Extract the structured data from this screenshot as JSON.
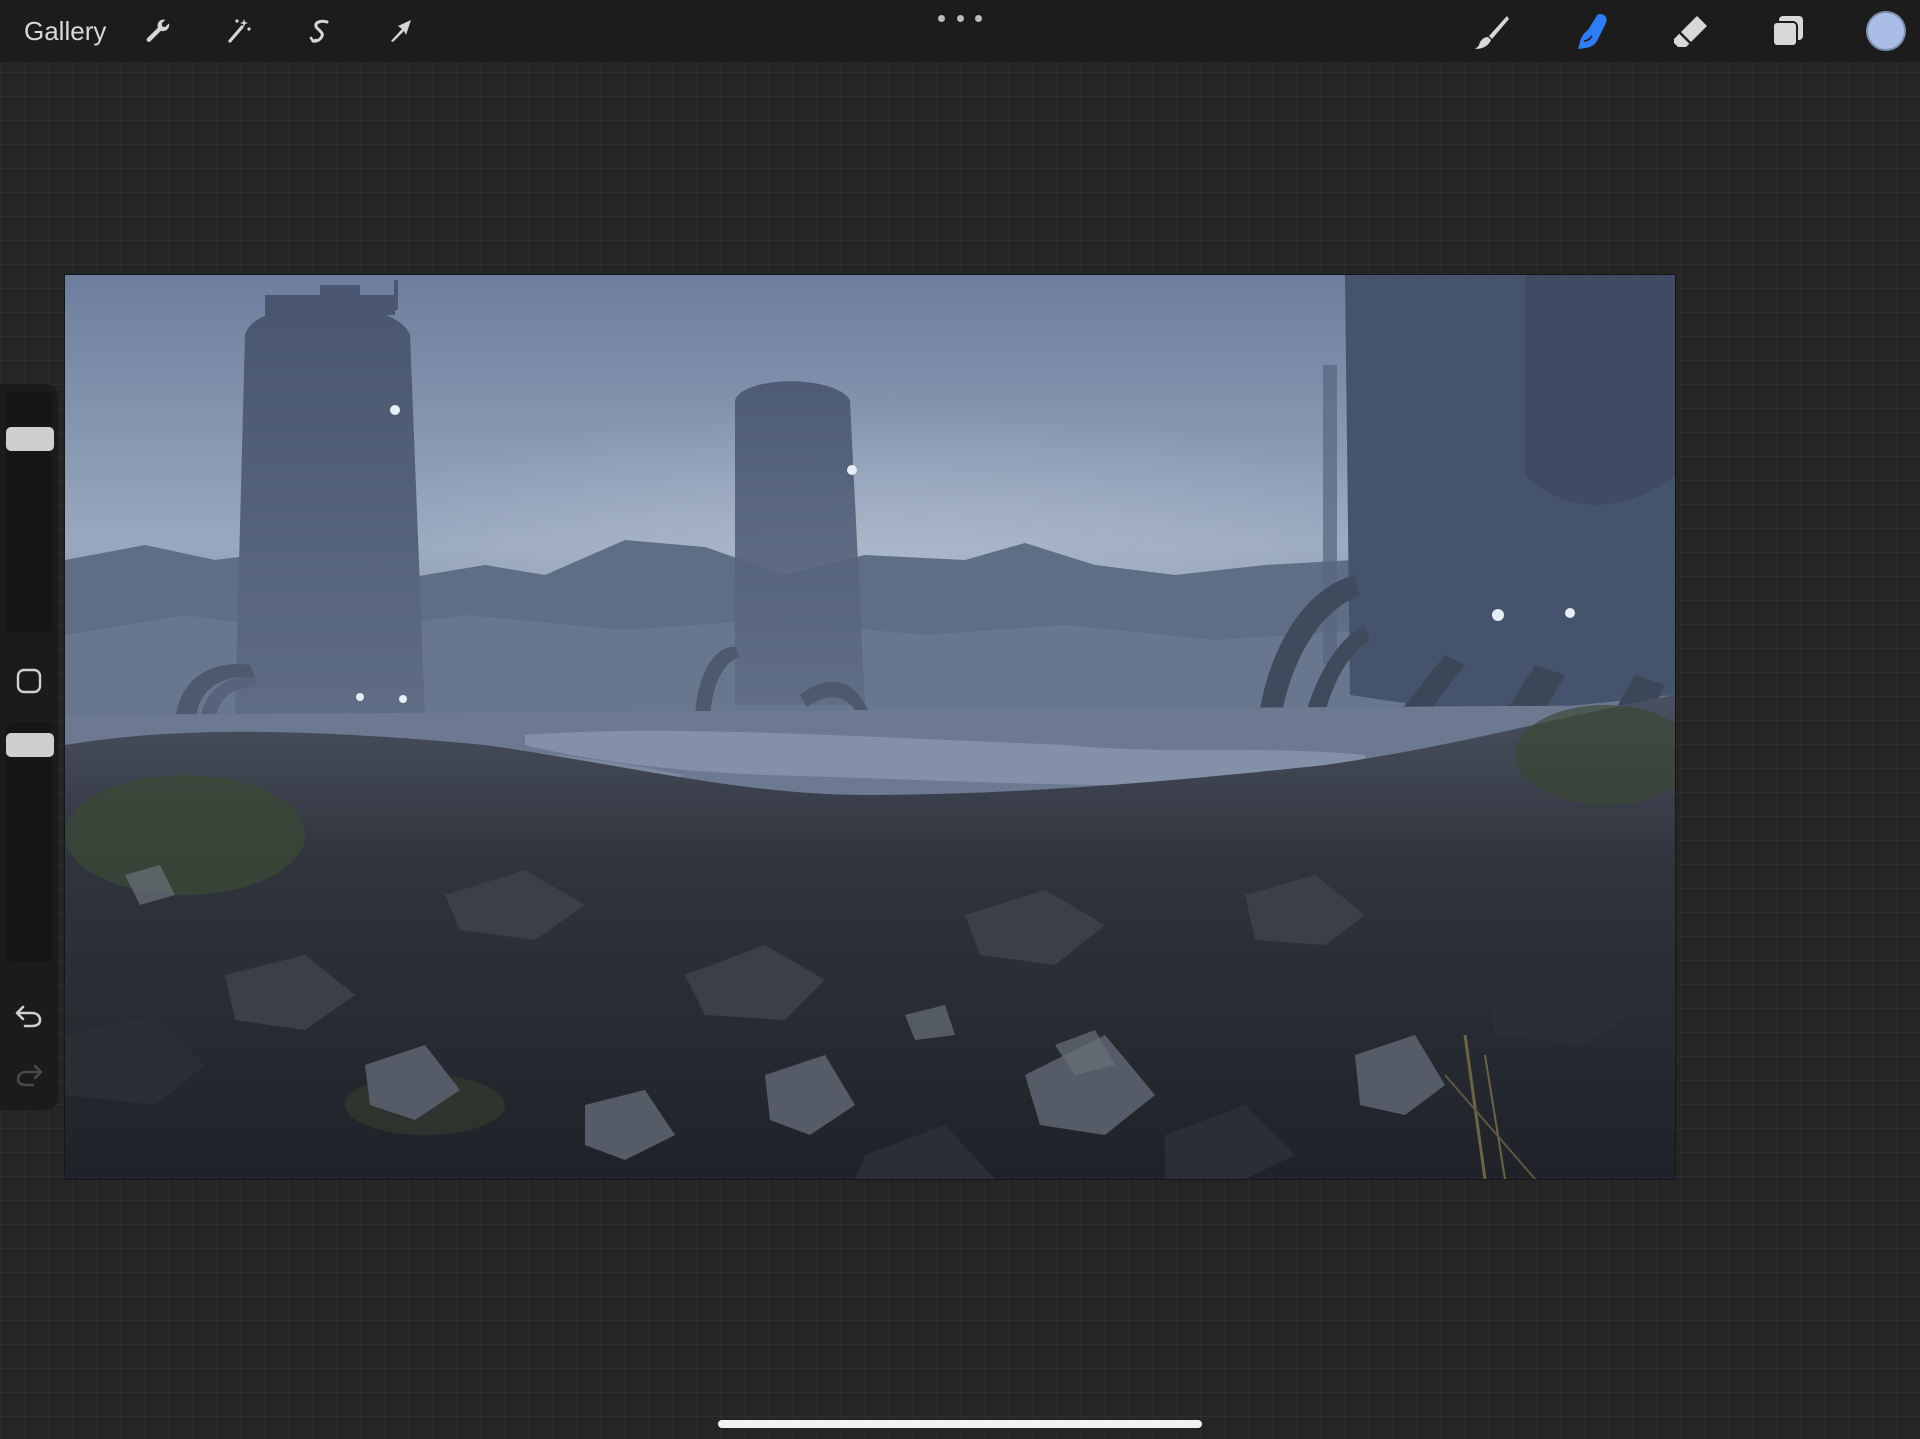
{
  "toolbar": {
    "gallery_label": "Gallery",
    "left_tools": [
      {
        "name": "actions",
        "icon": "wrench-icon"
      },
      {
        "name": "adjustments",
        "icon": "magic-wand-icon"
      },
      {
        "name": "selection",
        "icon": "selection-s-icon"
      },
      {
        "name": "transform",
        "icon": "arrow-cursor-icon"
      }
    ],
    "more_icon": "more-dots-icon",
    "right_tools": [
      {
        "name": "brush",
        "icon": "brush-icon",
        "active": false
      },
      {
        "name": "smudge",
        "icon": "smudge-finger-icon",
        "active": true
      },
      {
        "name": "eraser",
        "icon": "eraser-icon",
        "active": false
      },
      {
        "name": "layers",
        "icon": "layers-icon",
        "active": false
      }
    ],
    "active_color": "#a9bde6",
    "accent_color": "#2f7df6"
  },
  "sidebar": {
    "brush_size_level": 0.84,
    "opacity_level": 0.95,
    "modify_icon": "square-modify-icon",
    "undo_icon": "undo-icon",
    "redo_icon": "redo-icon",
    "redo_enabled": false
  },
  "canvas": {
    "artwork": "painting",
    "sky_color": "#7f90ad",
    "mountain_color": "#5d6b82",
    "tower_color": "#4f5d75",
    "ground_color": "#2b2f36"
  }
}
